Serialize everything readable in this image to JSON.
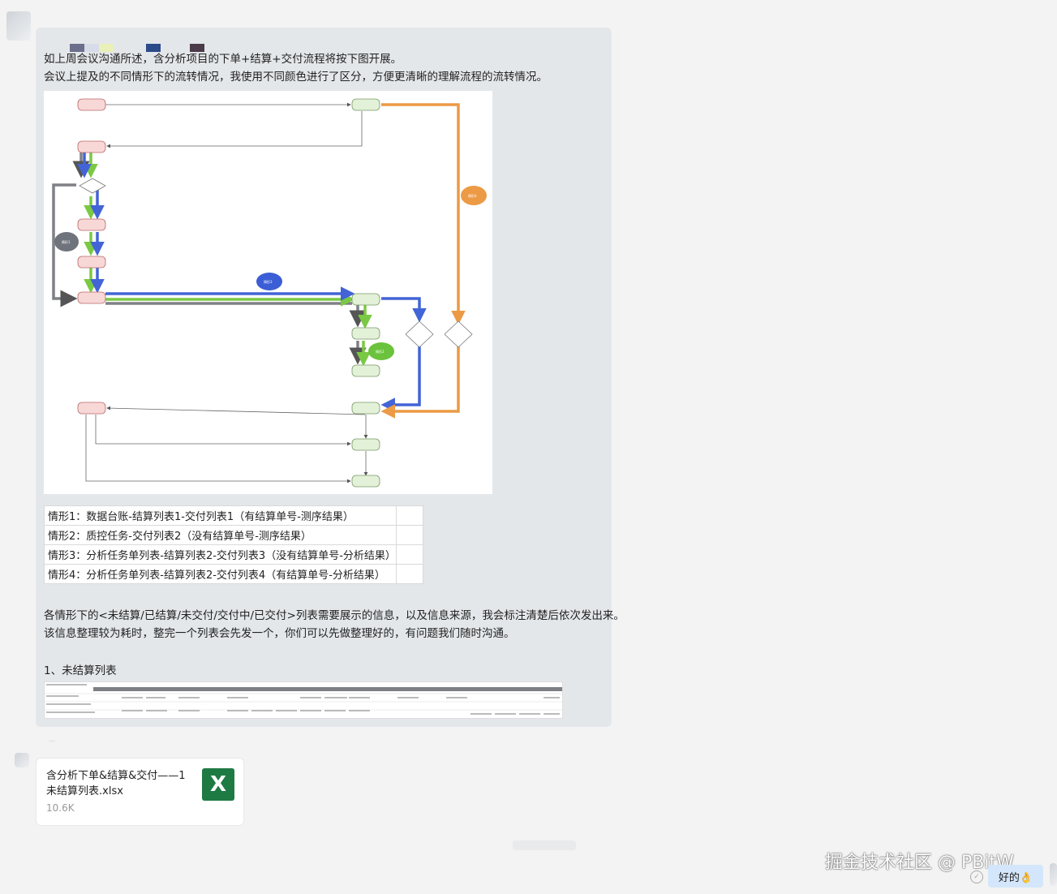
{
  "message": {
    "line1": "如上周会议沟通所述，含分析项目的下单+结算+交付流程将按下图开展。",
    "line2": "会议上提及的不同情形下的流转情况，我使用不同颜色进行了区分，方便更清晰的理解流程的流转情况。",
    "swatch_colors": [
      "#6b6f8a",
      "#d8dbe8",
      "#e9f0b8",
      "#2b4b8a",
      "#4b3a4a"
    ],
    "cases": [
      "情形1：数据台账-结算列表1-交付列表1（有结算单号-测序结果）",
      "情形2：质控任务-交付列表2（没有结算单号-测序结果）",
      "情形3：分析任务单列表-结算列表2-交付列表3（没有结算单号-分析结果）",
      "情形4：分析任务单列表-结算列表2-交付列表4（有结算单号-分析结果）"
    ],
    "para1": "各情形下的<未结算/已结算/未交付/交付中/已交付>列表需要展示的信息，以及信息来源，我会标注清楚后依次发出来。",
    "para2": "该信息整理较为耗时，整完一个列表会先发一个，你们可以先做整理好的，有问题我们随时沟通。",
    "section_title": "1、未结算列表"
  },
  "diagram": {
    "colors": {
      "gray": "#7f8186",
      "green": "#7ac943",
      "blue": "#4264d6",
      "orange": "#ec9a45",
      "node_red_fill": "#f8d7d7",
      "node_red_border": "#b86a6a",
      "node_green_fill": "#e3f1d8",
      "node_green_border": "#7a9a6a"
    },
    "legend_bubbles": [
      "情形1",
      "情形2",
      "情形3",
      "情形4"
    ]
  },
  "file": {
    "name": "含分析下单&结算&交付——1未结算列表.xlsx",
    "size": "10.6K",
    "icon": "excel-icon",
    "icon_letter": "X"
  },
  "footer": {
    "watermark": "掘金技术社区 @ PBitW",
    "reply_text": "好的👌"
  }
}
